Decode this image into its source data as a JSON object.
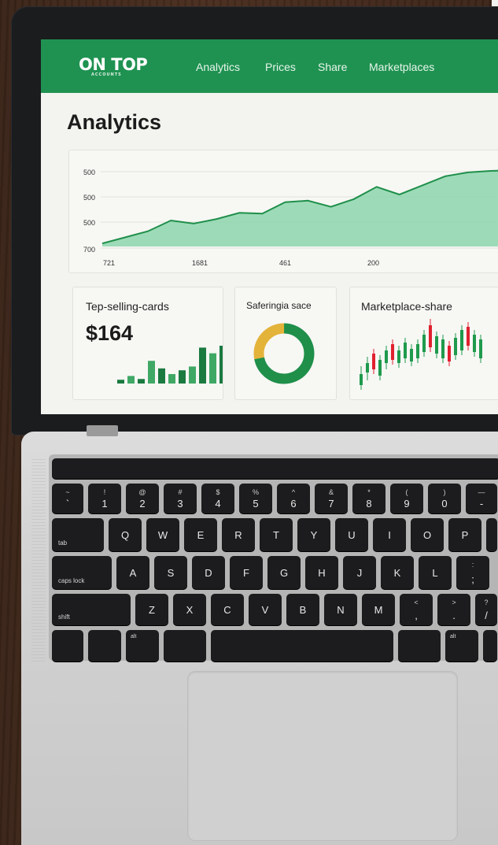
{
  "brand": {
    "logo": "ON TOP",
    "sub": "ACCOUNTS"
  },
  "nav": {
    "items": [
      "Analytics",
      "Prices",
      "Share",
      "Marketplaces"
    ]
  },
  "page_title": "Analytics",
  "chart_data": {
    "type": "area",
    "yticks": [
      "500",
      "500",
      "500",
      "700"
    ],
    "xticks": [
      "721",
      "1681",
      "461",
      "200"
    ],
    "series": [
      {
        "values": [
          0.04,
          0.12,
          0.2,
          0.34,
          0.3,
          0.36,
          0.44,
          0.43,
          0.58,
          0.6,
          0.52,
          0.62,
          0.78,
          0.68,
          0.8,
          0.92,
          0.97,
          0.99,
          1.0
        ]
      }
    ],
    "grid": true,
    "color": "#7fd1a4"
  },
  "cards": [
    {
      "title": "Tep-selling-cards",
      "value": "$164",
      "bars": [
        0.1,
        0.2,
        0.12,
        0.6,
        0.4,
        0.25,
        0.35,
        0.45,
        0.95,
        0.8,
        1.0
      ]
    },
    {
      "title": "Saferingia sace",
      "donut": {
        "green": 0.72,
        "yellow": 0.28
      }
    },
    {
      "title": "Marketplace-share"
    }
  ],
  "colors": {
    "nav": "#1f9251",
    "accent": "#1f8f4a",
    "yellow": "#e3b33a",
    "red": "#e0212f"
  },
  "keyboard": {
    "row1": [
      [
        "~",
        "`"
      ],
      [
        "!",
        "1"
      ],
      [
        "@",
        "2"
      ],
      [
        "#",
        "3"
      ],
      [
        "$",
        "4"
      ],
      [
        "%",
        "5"
      ],
      [
        "^",
        "6"
      ],
      [
        "&",
        "7"
      ],
      [
        "*",
        "8"
      ],
      [
        "(",
        "9"
      ],
      [
        ")",
        "0"
      ],
      [
        "—",
        "-"
      ]
    ],
    "row2_label": "tab",
    "row2": [
      "Q",
      "W",
      "E",
      "R",
      "T",
      "Y",
      "U",
      "I",
      "O",
      "P"
    ],
    "row3_label": "caps lock",
    "row3": [
      "A",
      "S",
      "D",
      "F",
      "G",
      "H",
      "J",
      "K",
      "L"
    ],
    "row3_end": [
      ":",
      ";"
    ],
    "row4_label": "shift",
    "row4": [
      "Z",
      "X",
      "C",
      "V",
      "B",
      "N",
      "M"
    ],
    "row4_punct": [
      [
        "<",
        ","
      ],
      [
        ">",
        "."
      ],
      [
        "?",
        "/"
      ]
    ],
    "alt": "alt"
  }
}
